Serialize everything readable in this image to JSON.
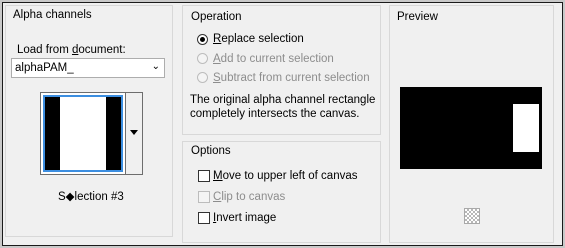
{
  "alpha_channels": {
    "title": "Alpha channels",
    "load_label_before": "Load from ",
    "load_label_mnemonic": "d",
    "load_label_after": "ocument:",
    "document_value": "alphaPAM_",
    "selection_label": "S◆lection #3"
  },
  "operation": {
    "title": "Operation",
    "replace_mnemonic": "R",
    "replace_rest": "eplace selection",
    "add_mnemonic": "A",
    "add_rest": "dd to current selection",
    "subtract_mnemonic": "S",
    "subtract_rest": "ubtract from current selection",
    "message_line1": "The original alpha channel rectangle",
    "message_line2": "completely intersects the canvas."
  },
  "options": {
    "title": "Options",
    "move_mnemonic": "M",
    "move_rest": "ove to upper left of canvas",
    "clip_mnemonic": "C",
    "clip_rest": "lip to canvas",
    "invert_mnemonic": "I",
    "invert_rest": "nvert image"
  },
  "preview": {
    "title": "Preview",
    "zoom_icon": "checker-zoom-icon"
  },
  "colors": {
    "accent_blue": "#3c8ee0",
    "disabled_text": "#8d8d8d"
  }
}
